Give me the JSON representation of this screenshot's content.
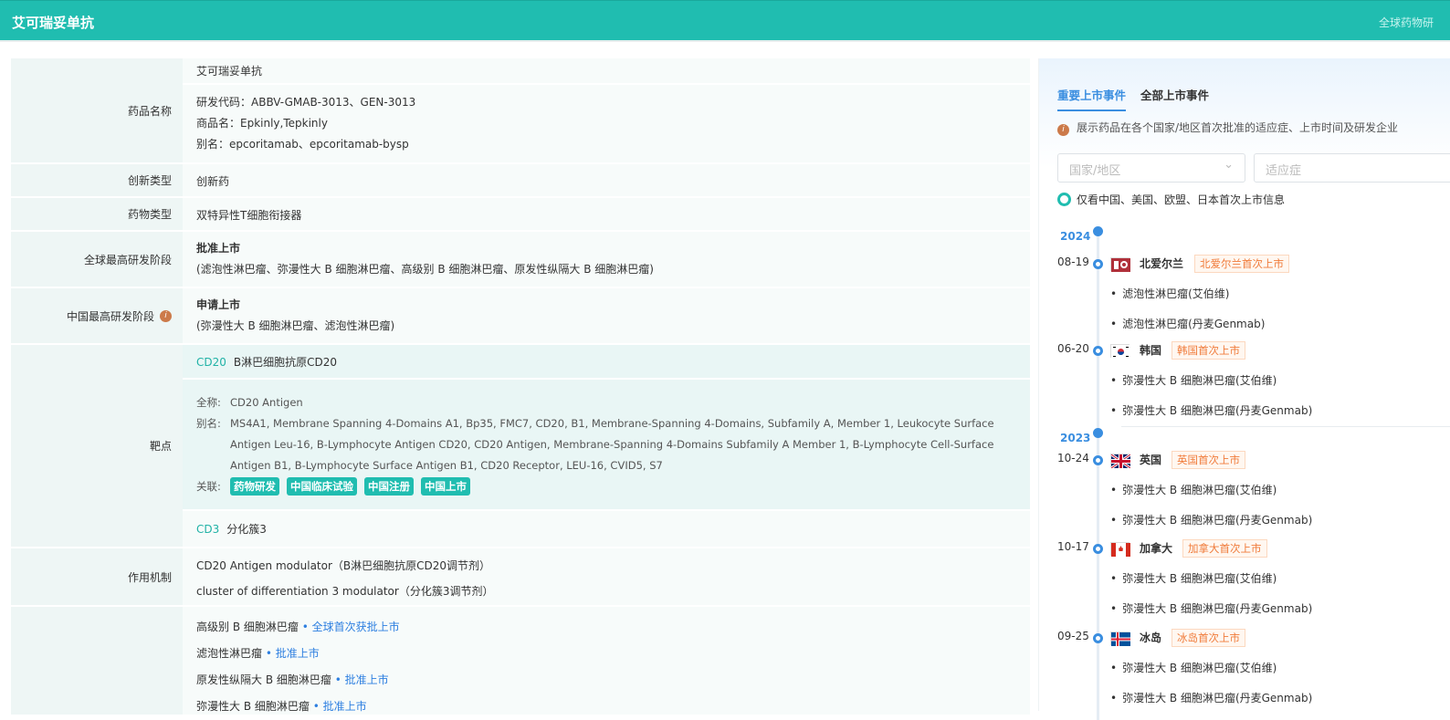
{
  "header": {
    "title": "艾可瑞妥单抗",
    "right_link": "全球药物研"
  },
  "table": {
    "drug_name": {
      "label": "药品名称",
      "name": "艾可瑞妥单抗",
      "codes": "研发代码：ABBV-GMAB-3013、GEN-3013",
      "trade": "商品名：Epkinly,Tepkinly",
      "alias": "别名：epcoritamab、epcoritamab-bysp"
    },
    "innovation": {
      "label": "创新类型",
      "value": "创新药"
    },
    "drug_type": {
      "label": "药物类型",
      "value": "双特异性T细胞衔接器"
    },
    "global_phase": {
      "label": "全球最高研发阶段",
      "stage": "批准上市",
      "detail": "(滤泡性淋巴瘤、弥漫性大 B 细胞淋巴瘤、高级别 B 细胞淋巴瘤、原发性纵隔大 B 细胞淋巴瘤)"
    },
    "china_phase": {
      "label": "中国最高研发阶段",
      "stage": "申请上市",
      "detail": "(弥漫性大 B 细胞淋巴瘤、滤泡性淋巴瘤)"
    },
    "target": {
      "label": "靶点",
      "t1_code": "CD20",
      "t1_name": "B淋巴细胞抗原CD20",
      "full_k": "全称:",
      "full_v": "CD20 Antigen",
      "alias_k": "别名:",
      "alias_v": "MS4A1, Membrane Spanning 4-Domains A1, Bp35, FMC7, CD20, B1, Membrane-Spanning 4-Domains, Subfamily A, Member 1, Leukocyte Surface Antigen Leu-16, B-Lymphocyte Antigen CD20, CD20 Antigen, Membrane-Spanning 4-Domains Subfamily A Member 1, B-Lymphocyte Cell-Surface Antigen B1, B-Lymphocyte Surface Antigen B1, CD20 Receptor, LEU-16, CVID5, S7",
      "rel_k": "关联:",
      "tags": [
        "药物研发",
        "中国临床试验",
        "中国注册",
        "中国上市"
      ],
      "t2_code": "CD3",
      "t2_name": "分化簇3"
    },
    "mechanism": {
      "label": "作用机制",
      "items": [
        "CD20 Antigen modulator（B淋巴细胞抗原CD20调节剂）",
        "cluster of differentiation 3 modulator（分化簇3调节剂）"
      ]
    },
    "indications": [
      {
        "name": "高级别 B 细胞淋巴瘤",
        "status": "• 全球首次获批上市"
      },
      {
        "name": "滤泡性淋巴瘤",
        "status": "• 批准上市"
      },
      {
        "name": "原发性纵隔大 B 细胞淋巴瘤",
        "status": "• 批准上市"
      },
      {
        "name": "弥漫性大 B 细胞淋巴瘤",
        "status": "• 批准上市"
      }
    ]
  },
  "panel": {
    "tabs": [
      "重要上市事件",
      "全部上市事件"
    ],
    "tip": "展示药品在各个国家/地区首次批准的适应症、上市时间及研发企业",
    "country_placeholder": "国家/地区",
    "indication_placeholder": "适应症",
    "toggle_label": "仅看中国、美国、欧盟、日本首次上市信息",
    "years": [
      "2024",
      "2023"
    ],
    "events": [
      {
        "date": "08-19",
        "country": "北爱尔兰",
        "badge": "北爱尔兰首次上市",
        "items": [
          "滤泡性淋巴瘤(艾伯维)",
          "滤泡性淋巴瘤(丹麦Genmab)"
        ]
      },
      {
        "date": "06-20",
        "country": "韩国",
        "badge": "韩国首次上市",
        "items": [
          "弥漫性大 B 细胞淋巴瘤(艾伯维)",
          "弥漫性大 B 细胞淋巴瘤(丹麦Genmab)"
        ]
      },
      {
        "date": "10-24",
        "country": "英国",
        "badge": "英国首次上市",
        "items": [
          "弥漫性大 B 细胞淋巴瘤(艾伯维)",
          "弥漫性大 B 细胞淋巴瘤(丹麦Genmab)"
        ]
      },
      {
        "date": "10-17",
        "country": "加拿大",
        "badge": "加拿大首次上市",
        "items": [
          "弥漫性大 B 细胞淋巴瘤(艾伯维)",
          "弥漫性大 B 细胞淋巴瘤(丹麦Genmab)"
        ]
      },
      {
        "date": "09-25",
        "country": "冰岛",
        "badge": "冰岛首次上市",
        "items": [
          "弥漫性大 B 细胞淋巴瘤(艾伯维)",
          "弥漫性大 B 细胞淋巴瘤(丹麦Genmab)"
        ]
      }
    ]
  }
}
